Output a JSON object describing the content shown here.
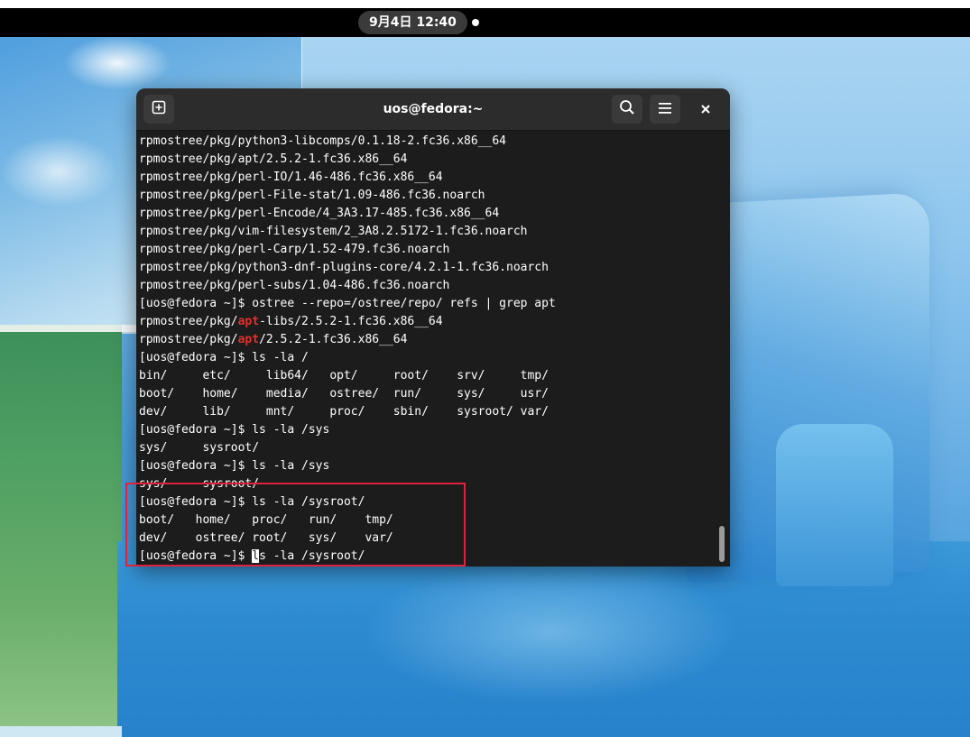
{
  "top_bar": {
    "clock": "9月4日  12:40"
  },
  "window": {
    "title": "uos@fedora:~"
  },
  "icons": {
    "new_tab": "new-tab-icon",
    "search": "search-icon",
    "menu": "hamburger-menu-icon",
    "close": "close-icon"
  },
  "colors": {
    "grep_match": "#e0312c",
    "highlight_box": "#e0213c",
    "terminal_bg": "#1c1c1c",
    "headerbar_bg": "#2c2c2c"
  },
  "terminal": {
    "lines": [
      "rpmostree/pkg/python3-libcomps/0.1.18-2.fc36.x86__64",
      "rpmostree/pkg/apt/2.5.2-1.fc36.x86__64",
      "rpmostree/pkg/perl-IO/1.46-486.fc36.x86__64",
      "rpmostree/pkg/perl-File-stat/1.09-486.fc36.noarch",
      "rpmostree/pkg/perl-Encode/4_3A3.17-485.fc36.x86__64",
      "rpmostree/pkg/vim-filesystem/2_3A8.2.5172-1.fc36.noarch",
      "rpmostree/pkg/perl-Carp/1.52-479.fc36.noarch",
      "rpmostree/pkg/python3-dnf-plugins-core/4.2.1-1.fc36.noarch",
      "rpmostree/pkg/perl-subs/1.04-486.fc36.noarch",
      "[uos@fedora ~]$ ostree --repo=/ostree/repo/ refs | grep apt",
      {
        "pre": "rpmostree/pkg/",
        "match": "apt",
        "post": "-libs/2.5.2-1.fc36.x86__64"
      },
      {
        "pre": "rpmostree/pkg/",
        "match": "apt",
        "post": "/2.5.2-1.fc36.x86__64"
      },
      "[uos@fedora ~]$ ls -la /",
      "bin/     etc/     lib64/   opt/     root/    srv/     tmp/",
      "boot/    home/    media/   ostree/  run/     sys/     usr/",
      "dev/     lib/     mnt/     proc/    sbin/    sysroot/ var/",
      "[uos@fedora ~]$ ls -la /sys",
      "sys/     sysroot/",
      "[uos@fedora ~]$ ls -la /sys",
      "sys/     sysroot/",
      "[uos@fedora ~]$ ls -la /sysroot/",
      "boot/   home/   proc/   run/    tmp/",
      "dev/    ostree/ root/   sys/    var/"
    ],
    "prompt_line": {
      "prompt": "[uos@fedora ~]$ ",
      "cursor_char": "l",
      "rest": "s -la /sysroot/"
    }
  }
}
